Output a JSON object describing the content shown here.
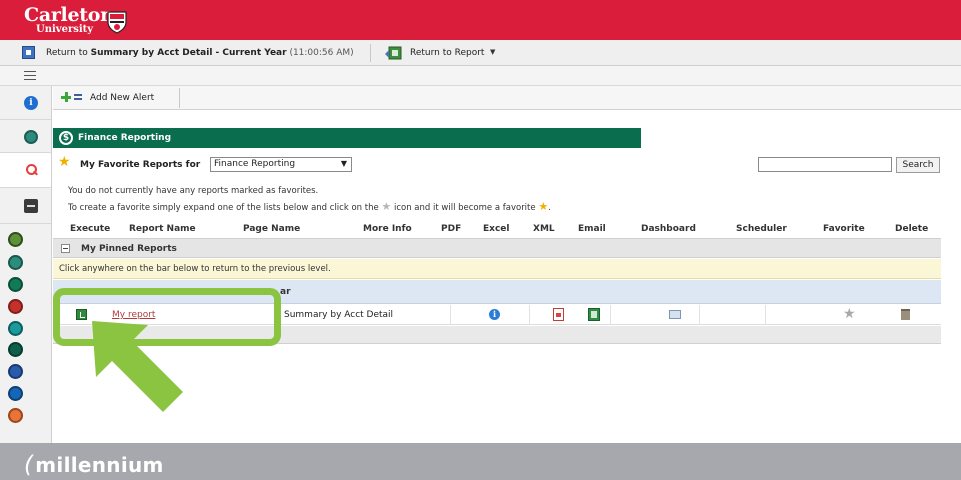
{
  "header": {
    "logo_line1": "Carleton",
    "logo_line2": "University",
    "brand_color": "#da1d3a"
  },
  "breadcrumb": {
    "prefix": "Return to ",
    "title": "Summary by Acct Detail - Current Year",
    "time": "(11:00:56 AM)",
    "return_to_report_label": "Return to Report"
  },
  "toolbar": {
    "add_alert_label": "Add New Alert"
  },
  "section": {
    "title": "Finance Reporting",
    "color": "#0a6d4d"
  },
  "favorites": {
    "label": "My Favorite Reports  for",
    "selected_value": "Finance Reporting",
    "search_button_label": "Search",
    "search_value": "",
    "message_line1": "You do not currently have any reports marked as favorites.",
    "message_line2_start": "To create a favorite simply expand one of the lists below and click on the",
    "message_line2_end": "icon and it will become a favorite"
  },
  "table": {
    "columns": [
      "Execute",
      "Report Name",
      "Page Name",
      "More Info",
      "PDF",
      "Excel",
      "XML",
      "Email",
      "Dashboard",
      "Scheduler",
      "Favorite",
      "Delete"
    ],
    "pinned_group_label": "My Pinned Reports",
    "navigate_message": "Click anywhere on the bar below to return to the previous level.",
    "group_bar_text": "ar",
    "rows": [
      {
        "report_name": "My report",
        "page_name": "Summary by Acct Detail"
      }
    ]
  },
  "footer": {
    "logo_text": "millennium",
    "bracket": "("
  },
  "icons": {
    "sidebar": [
      "info-icon",
      "teal-module-icon",
      "search-icon",
      "drawer-icon"
    ],
    "modules": [
      "module-icon-1",
      "module-icon-2",
      "finance-icon",
      "module-icon-4",
      "module-icon-5",
      "module-icon-6",
      "module-icon-7",
      "module-icon-8",
      "module-icon-9"
    ],
    "highlight_color": "#8ac440"
  }
}
